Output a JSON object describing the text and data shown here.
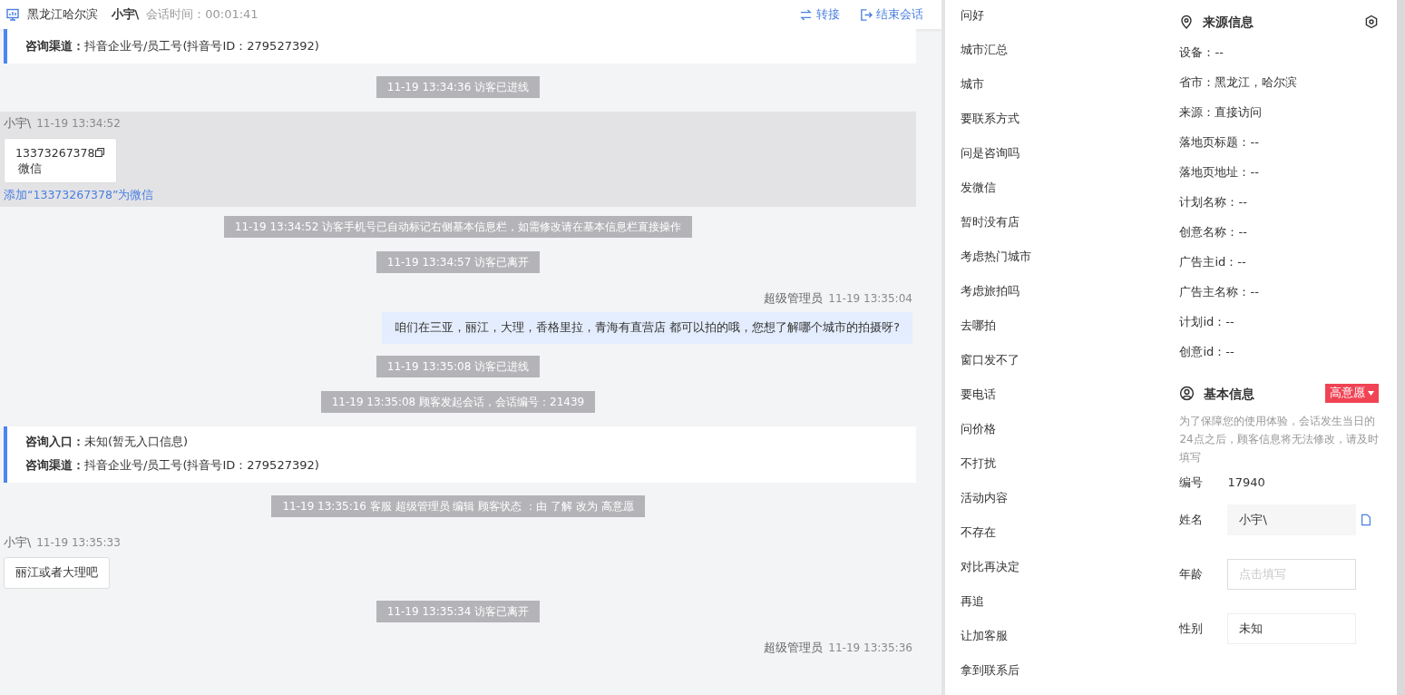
{
  "header": {
    "location": "黑龙江哈尔滨",
    "visitor": "小宇\\",
    "session_label": "会话时间：",
    "session_time": "00:01:41",
    "actions": [
      {
        "label": "转接"
      },
      {
        "label": "结束会话"
      }
    ]
  },
  "chat": [
    {
      "kind": "info",
      "lines": [
        {
          "label": "咨询渠道：",
          "value": "抖音企业号/员工号(抖音号ID：279527392)"
        }
      ]
    },
    {
      "kind": "system",
      "text": "11-19 13:34:36 访客已进线"
    },
    {
      "kind": "visitor",
      "name": "小宇\\",
      "time": "11-19 13:34:52",
      "highlighted": true,
      "contact": {
        "number": "13373267378",
        "type": "微信"
      },
      "link": "添加“13373267378”为微信"
    },
    {
      "kind": "system",
      "text": "11-19 13:34:52 访客手机号已自动标记右侧基本信息栏，如需修改请在基本信息栏直接操作"
    },
    {
      "kind": "system",
      "text": "11-19 13:34:57 访客已离开"
    },
    {
      "kind": "agent",
      "name": "超级管理员",
      "time": "11-19 13:35:04",
      "text": "咱们在三亚，丽江，大理，香格里拉，青海有直营店 都可以拍的哦，您想了解哪个城市的拍摄呀?"
    },
    {
      "kind": "system",
      "text": "11-19 13:35:08 访客已进线"
    },
    {
      "kind": "system",
      "text": "11-19 13:35:08 顾客发起会话，会话编号：21439"
    },
    {
      "kind": "info",
      "lines": [
        {
          "label": "咨询入口：",
          "value": "未知(暂无入口信息)"
        },
        {
          "label": "咨询渠道：",
          "value": "抖音企业号/员工号(抖音号ID：279527392)"
        }
      ]
    },
    {
      "kind": "system",
      "text": "11-19 13:35:16 客服 超级管理员 编辑 顾客状态 ：由 了解 改为 高意愿"
    },
    {
      "kind": "visitor",
      "name": "小宇\\",
      "time": "11-19 13:35:33",
      "highlighted": false,
      "text": "丽江或者大理吧"
    },
    {
      "kind": "system",
      "text": "11-19 13:35:34 访客已离开"
    },
    {
      "kind": "agent",
      "name": "超级管理员",
      "time": "11-19 13:35:36"
    }
  ],
  "phrases": [
    "问好",
    "城市汇总",
    "城市",
    "要联系方式",
    "问是咨询吗",
    "发微信",
    "暂时没有店",
    "考虑热门城市",
    "考虑旅拍吗",
    "去哪拍",
    "窗口发不了",
    "要电话",
    "问价格",
    "不打扰",
    "活动内容",
    "不存在",
    "对比再决定",
    "再追",
    "让加客服",
    "拿到联系后"
  ],
  "source": {
    "title": "来源信息",
    "fields": [
      "设备：--",
      "省市：黑龙江，哈尔滨",
      "来源：直接访问",
      "落地页标题：--",
      "落地页地址：--",
      "计划名称：--",
      "创意名称：--",
      "广告主id：--",
      "广告主名称：--",
      "计划id：--",
      "创意id：--"
    ]
  },
  "basic": {
    "title": "基本信息",
    "status": "高意愿",
    "note": "为了保障您的使用体验，会话发生当日的24点之后，顾客信息将无法修改，请及时填写",
    "fields": [
      {
        "kind": "text",
        "label": "编号",
        "value": "17940"
      },
      {
        "kind": "readonly",
        "label": "姓名",
        "value": "小宇\\"
      },
      {
        "kind": "input",
        "label": "年龄",
        "placeholder": "点击填写"
      },
      {
        "kind": "select",
        "label": "性别",
        "value": "未知"
      }
    ]
  }
}
